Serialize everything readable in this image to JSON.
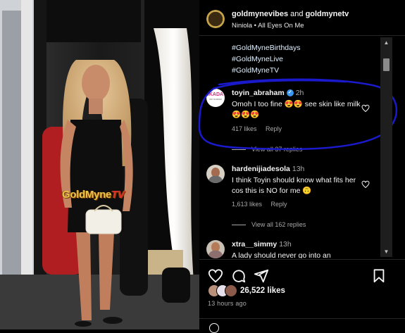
{
  "header": {
    "account": "goldmynevibes",
    "connector": "and",
    "collaborator": "goldmynetv",
    "audio": "Niniola • All Eyes On Me"
  },
  "video": {
    "watermark_main": "GoldMyne",
    "watermark_accent": "TV"
  },
  "caption_tags": [
    "#GoldMyneBirthdays",
    "#GoldMyneLive",
    "#GoldMyneTV"
  ],
  "comments": [
    {
      "username": "toyin_abraham",
      "verified": true,
      "time": "2h",
      "text": "Omoh I too fine 😍😍 see skin like milk😍😍😍",
      "likes": "417 likes",
      "reply": "Reply",
      "view_replies": "View all 37 replies",
      "avatar_text": "IKADA",
      "avatar_subtext": "WO NOIRAR"
    },
    {
      "username": "hardenijiadesola",
      "verified": false,
      "time": "13h",
      "text": "I think Toyin should know what fits her cos this is NO for me 🙃",
      "likes": "1,613 likes",
      "reply": "Reply",
      "view_replies": "View all 162 replies"
    },
    {
      "username": "xtra__simmy",
      "verified": false,
      "time": "13h",
      "text": "A lady should never go into an"
    }
  ],
  "actions": {
    "like_icon": "heart-icon",
    "comment_icon": "comment-icon",
    "share_icon": "share-icon",
    "save_icon": "bookmark-icon"
  },
  "likes_total": "26,522 likes",
  "posted_ago": "13 hours ago",
  "scrollbar": {
    "up": "▲",
    "down": "▼"
  },
  "colors": {
    "background": "#000000",
    "verified": "#3897f0",
    "annotation": "#1a1acc",
    "watermark": "#e8c44a"
  }
}
